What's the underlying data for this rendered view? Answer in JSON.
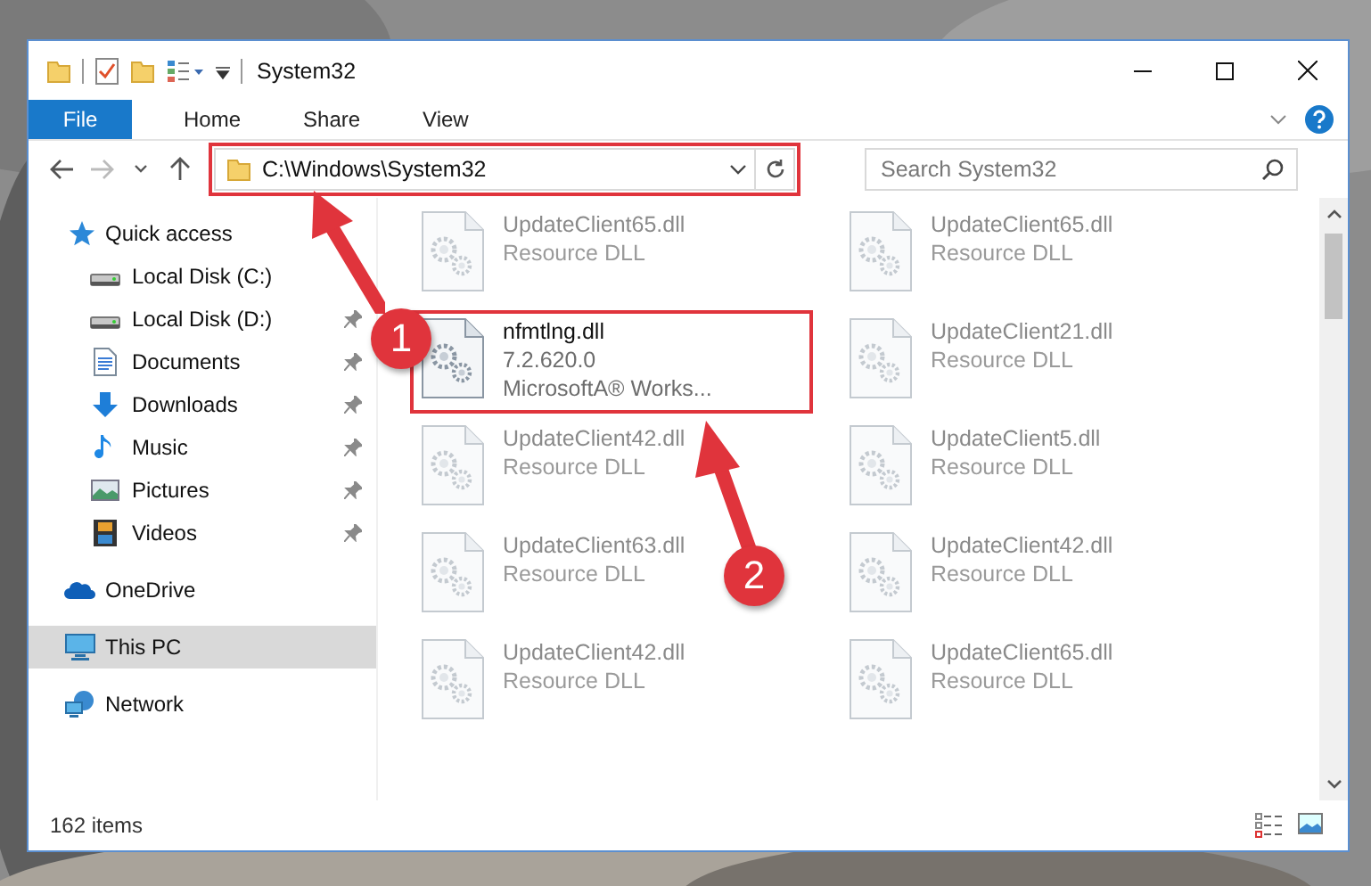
{
  "window": {
    "title": "System32"
  },
  "ribbon_tabs": [
    {
      "label": "File",
      "kind": "file"
    },
    {
      "label": "Home",
      "kind": "tab"
    },
    {
      "label": "Share",
      "kind": "tab"
    },
    {
      "label": "View",
      "kind": "tab"
    }
  ],
  "address_bar": {
    "value": "C:\\Windows\\System32",
    "highlighted": true
  },
  "search": {
    "placeholder": "Search System32"
  },
  "sidebar": {
    "items": [
      {
        "label": "Quick access",
        "kind": "star",
        "selected": false,
        "children": [
          {
            "label": "Local Disk (C:)",
            "kind": "drive",
            "pinned": false,
            "selected": false
          },
          {
            "label": "Local Disk (D:)",
            "kind": "drive",
            "pinned": true,
            "selected": false
          },
          {
            "label": "Documents",
            "kind": "documents",
            "pinned": true,
            "selected": false
          },
          {
            "label": "Downloads",
            "kind": "downloads",
            "pinned": true,
            "selected": false
          },
          {
            "label": "Music",
            "kind": "music",
            "pinned": true,
            "selected": false
          },
          {
            "label": "Pictures",
            "kind": "pictures",
            "pinned": true,
            "selected": false
          },
          {
            "label": "Videos",
            "kind": "videos",
            "pinned": true,
            "selected": false
          }
        ]
      },
      {
        "label": "OneDrive",
        "kind": "cloud",
        "selected": false
      },
      {
        "label": "This PC",
        "kind": "pc",
        "selected": true
      },
      {
        "label": "Network",
        "kind": "network",
        "selected": false
      }
    ]
  },
  "files": [
    {
      "name": "UpdateClient65.dll",
      "details": [
        "Resource DLL"
      ],
      "faded": true,
      "highlighted": false
    },
    {
      "name": "UpdateClient65.dll",
      "details": [
        "Resource DLL"
      ],
      "faded": true,
      "highlighted": false
    },
    {
      "name": "nfmtlng.dll",
      "details": [
        "7.2.620.0",
        "MicrosoftA® Works..."
      ],
      "faded": false,
      "highlighted": true
    },
    {
      "name": "UpdateClient21.dll",
      "details": [
        "Resource DLL"
      ],
      "faded": true,
      "highlighted": false
    },
    {
      "name": "UpdateClient42.dll",
      "details": [
        "Resource DLL"
      ],
      "faded": true,
      "highlighted": false
    },
    {
      "name": "UpdateClient5.dll",
      "details": [
        "Resource DLL"
      ],
      "faded": true,
      "highlighted": false
    },
    {
      "name": "UpdateClient63.dll",
      "details": [
        "Resource DLL"
      ],
      "faded": true,
      "highlighted": false
    },
    {
      "name": "UpdateClient42.dll",
      "details": [
        "Resource DLL"
      ],
      "faded": true,
      "highlighted": false
    },
    {
      "name": "UpdateClient42.dll",
      "details": [
        "Resource DLL"
      ],
      "faded": true,
      "highlighted": false
    },
    {
      "name": "UpdateClient65.dll",
      "details": [
        "Resource DLL"
      ],
      "faded": true,
      "highlighted": false
    }
  ],
  "status_bar": {
    "item_count": "162 items"
  },
  "annotations": [
    {
      "number": "1"
    },
    {
      "number": "2"
    }
  ]
}
